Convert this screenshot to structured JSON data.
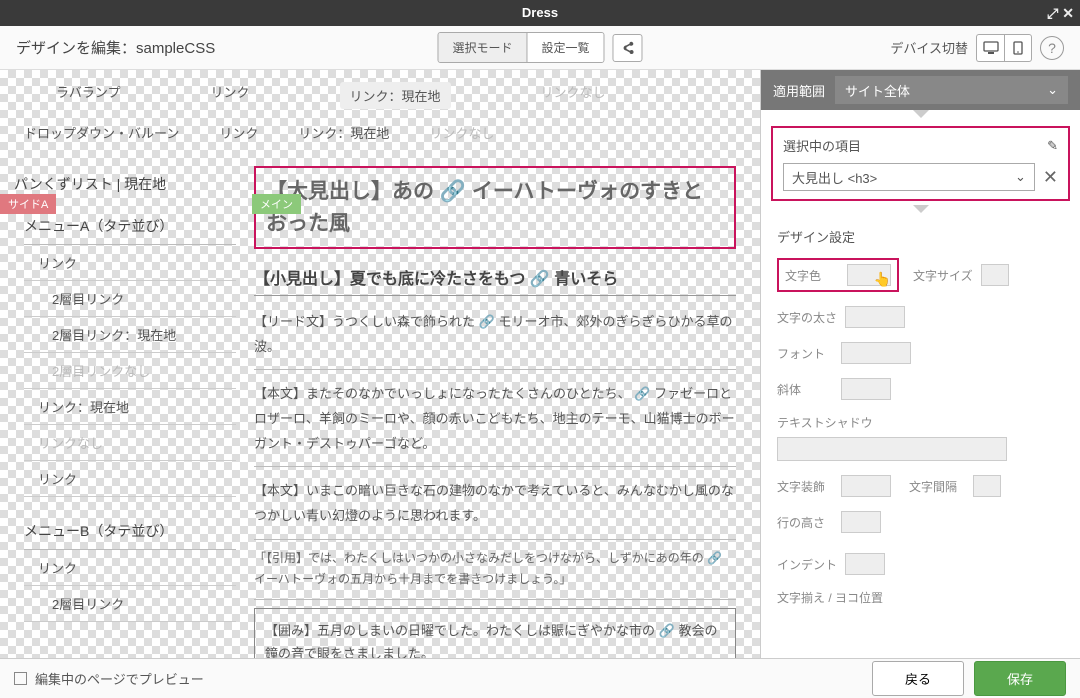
{
  "titlebar": {
    "title": "Dress"
  },
  "toolbar": {
    "edit_title": "デザインを編集：sampleCSS",
    "mode_select": "選択モード",
    "mode_list": "設定一覧",
    "device_label": "デバイス切替"
  },
  "preview": {
    "row1": {
      "lava": "ラバランプ",
      "link": "リンク",
      "link_current": "リンク：現在地",
      "link_none": "リンクなし"
    },
    "row2": {
      "dropdown": "ドロップダウン・バルーン",
      "link": "リンク",
      "link_current": "リンク：現在地",
      "link_none": "リンクなし"
    },
    "badge_side": "サイドA",
    "badge_main": "メイン",
    "side": {
      "breadcrumb": "パンくずリスト | 現在地",
      "menuA": "メニューA（タテ並び）",
      "items": [
        {
          "t": "リンク",
          "cls": ""
        },
        {
          "t": "2層目リンク",
          "cls": "sub"
        },
        {
          "t": "2層目リンク：現在地",
          "cls": "sub"
        },
        {
          "t": "2層目リンクなし",
          "cls": "sub dis"
        },
        {
          "t": "リンク：現在地",
          "cls": ""
        },
        {
          "t": "リンクなし",
          "cls": "dis"
        },
        {
          "t": "リンク",
          "cls": ""
        }
      ],
      "menuB": "メニューB（タテ並び）",
      "itemsB": [
        {
          "t": "リンク",
          "cls": ""
        },
        {
          "t": "2層目リンク",
          "cls": "sub"
        }
      ]
    },
    "main": {
      "h3_a": "【大見出し】あの",
      "h3_b": "イーハトーヴォ",
      "h3_c": "のすきとおった風",
      "h4_a": "【小見出し】夏でも底に冷たさをもつ",
      "h4_b": "青いそら",
      "lead_a": "【リード文】うつくしい森で飾られた",
      "lead_b": "モリーオ市、郊外のぎらぎらひかる草の波。",
      "body1_a": "【本文】またそのなかでいっしょになったたくさんのひとたち、",
      "body1_b": "ファゼーロとロザーロ、羊飼のミーロや、顔の赤いこどもたち、地主のテーモ、山猫博士のボーガント・デストゥパーゴなど。",
      "body2": "【本文】いまこの暗い巨きな石の建物のなかで考えていると、みんなむかし風のなつかしい青い幻燈のように思われます。",
      "quote_a": "「【引用】では、わたくしはいつかの小さなみだしをつけながら、しずかにあの年の",
      "quote_b": "イーハトーヴォの五月から十月までを書きつけましょう。」",
      "boxed_a": "【囲み】五月のしまいの日曜でした。わたくしは賑にぎやかな市の",
      "boxed_b": "教会の鐘の音で眼をさましました。"
    }
  },
  "panel": {
    "scope_label": "適用範囲",
    "scope_value": "サイト全体",
    "selected_label": "選択中の項目",
    "selected_value": "大見出し <h3>",
    "design_label": "デザイン設定",
    "props": {
      "color": "文字色",
      "size": "文字サイズ",
      "weight": "文字の太さ",
      "font": "フォント",
      "italic": "斜体",
      "shadow": "テキストシャドウ",
      "deco": "文字装飾",
      "spacing": "文字間隔",
      "lineh": "行の高さ",
      "indent": "インデント",
      "align": "文字揃え / ヨコ位置"
    }
  },
  "footer": {
    "preview_label": "編集中のページでプレビュー",
    "back": "戻る",
    "save": "保存"
  }
}
